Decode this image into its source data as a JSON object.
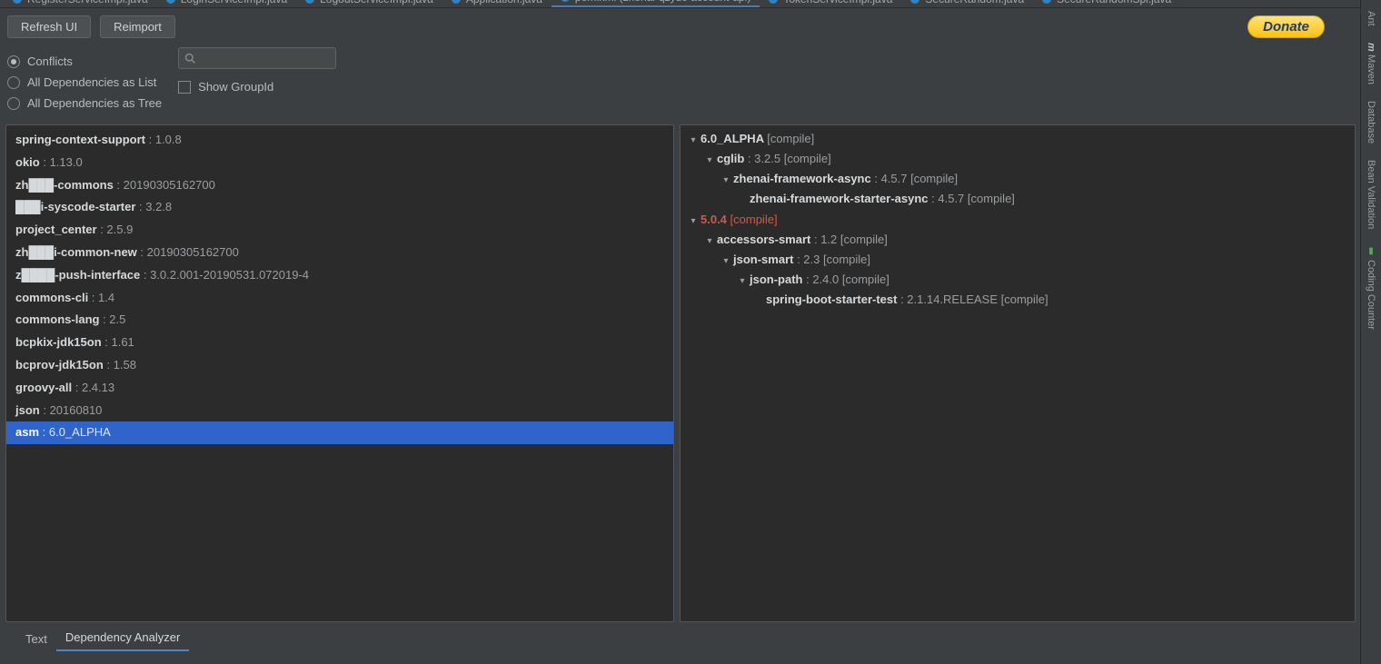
{
  "editor_tabs": [
    {
      "label": "RegisterServiceImpl.java",
      "icon": "java",
      "active": false
    },
    {
      "label": "LoginServiceImpl.java",
      "icon": "java",
      "active": false
    },
    {
      "label": "LogoutServiceImpl.java",
      "icon": "java",
      "active": false
    },
    {
      "label": "Application.java",
      "icon": "java",
      "active": false
    },
    {
      "label": "pom.xml (zhenai-qzydc-account-api)",
      "icon": "xml",
      "active": true
    },
    {
      "label": "TokenServiceImpl.java",
      "icon": "java",
      "active": false
    },
    {
      "label": "SecureRandom.java",
      "icon": "java",
      "active": false
    },
    {
      "label": "SecureRandomSpi.java",
      "icon": "java",
      "active": false
    }
  ],
  "toolbar": {
    "refresh_label": "Refresh UI",
    "reimport_label": "Reimport",
    "donate_label": "Donate"
  },
  "options": {
    "conflicts_label": "Conflicts",
    "all_list_label": "All Dependencies as List",
    "all_tree_label": "All Dependencies as Tree",
    "show_groupid_label": "Show GroupId",
    "search_placeholder": ""
  },
  "deps": [
    {
      "name": "spring-context-support",
      "ver": "1.0.8",
      "selected": false
    },
    {
      "name": "okio",
      "ver": "1.13.0",
      "selected": false
    },
    {
      "name": "zh███-commons",
      "ver": "20190305162700",
      "selected": false
    },
    {
      "name": "███i-syscode-starter",
      "ver": "3.2.8",
      "selected": false
    },
    {
      "name": "project_center",
      "ver": "2.5.9",
      "selected": false
    },
    {
      "name": "zh███i-common-new",
      "ver": "20190305162700",
      "selected": false
    },
    {
      "name": "z████-push-interface",
      "ver": "3.0.2.001-20190531.072019-4",
      "selected": false
    },
    {
      "name": "commons-cli",
      "ver": "1.4",
      "selected": false
    },
    {
      "name": "commons-lang",
      "ver": "2.5",
      "selected": false
    },
    {
      "name": "bcpkix-jdk15on",
      "ver": "1.61",
      "selected": false
    },
    {
      "name": "bcprov-jdk15on",
      "ver": "1.58",
      "selected": false
    },
    {
      "name": "groovy-all",
      "ver": "2.4.13",
      "selected": false
    },
    {
      "name": "json",
      "ver": "20160810",
      "selected": false
    },
    {
      "name": "asm",
      "ver": "6.0_ALPHA",
      "selected": true
    }
  ],
  "tree": [
    {
      "depth": 0,
      "caret": "▾",
      "name": "6.0_ALPHA",
      "rest": "[compile]",
      "conflict": false,
      "name_only": true
    },
    {
      "depth": 1,
      "caret": "▾",
      "name": "cglib",
      "rest": ": 3.2.5 [compile]",
      "conflict": false
    },
    {
      "depth": 2,
      "caret": "▾",
      "name": "zhenai-framework-async",
      "rest": ": 4.5.7 [compile]",
      "conflict": false
    },
    {
      "depth": 3,
      "caret": "",
      "name": "zhenai-framework-starter-async",
      "rest": ": 4.5.7 [compile]",
      "conflict": false
    },
    {
      "depth": 0,
      "caret": "▾",
      "name": "5.0.4",
      "rest": "[compile]",
      "conflict": true,
      "name_only": true
    },
    {
      "depth": 1,
      "caret": "▾",
      "name": "accessors-smart",
      "rest": ": 1.2 [compile]",
      "conflict": false
    },
    {
      "depth": 2,
      "caret": "▾",
      "name": "json-smart",
      "rest": ": 2.3 [compile]",
      "conflict": false
    },
    {
      "depth": 3,
      "caret": "▾",
      "name": "json-path",
      "rest": ": 2.4.0 [compile]",
      "conflict": false
    },
    {
      "depth": 4,
      "caret": "",
      "name": "spring-boot-starter-test",
      "rest": ": 2.1.14.RELEASE [compile]",
      "conflict": false
    }
  ],
  "bottom_tabs": {
    "text_label": "Text",
    "analyzer_label": "Dependency Analyzer"
  },
  "rail": {
    "ant": "Ant",
    "maven": "Maven",
    "database": "Database",
    "bean": "Bean Validation",
    "coding": "Coding Counter"
  }
}
